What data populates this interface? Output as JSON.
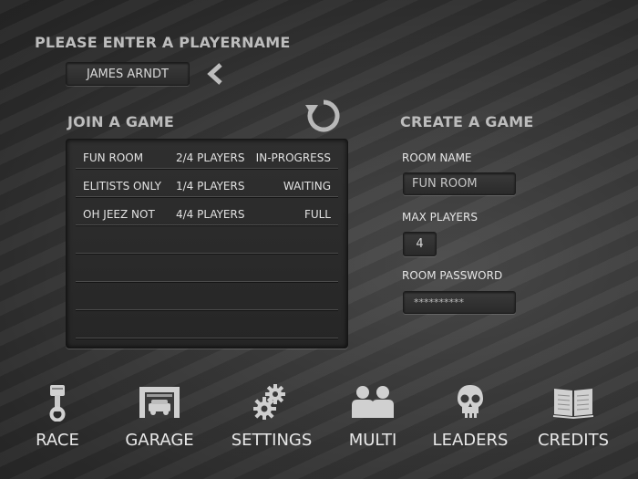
{
  "player": {
    "heading": "PLEASE ENTER A PLAYERNAME",
    "name_value": "JAMES ARNDT",
    "back_icon": "chevron-left-icon"
  },
  "join": {
    "heading": "JOIN A GAME",
    "refresh_icon": "refresh-icon",
    "rooms": [
      {
        "name": "FUN ROOM",
        "players": "2/4 PLAYERS",
        "status": "IN-PROGRESS"
      },
      {
        "name": "ELITISTS ONLY",
        "players": "1/4 PLAYERS",
        "status": "WAITING"
      },
      {
        "name": "OH JEEZ NOT",
        "players": "4/4 PLAYERS",
        "status": "FULL"
      }
    ]
  },
  "create": {
    "heading": "CREATE A GAME",
    "room_name_label": "ROOM NAME",
    "room_name_value": "FUN ROOM",
    "max_players_label": "MAX PLAYERS",
    "max_players_value": "4",
    "password_label": "ROOM PASSWORD",
    "password_value": "**********"
  },
  "nav": [
    {
      "label": "RACE",
      "icon": "piston-icon"
    },
    {
      "label": "GARAGE",
      "icon": "garage-icon"
    },
    {
      "label": "SETTINGS",
      "icon": "gears-icon"
    },
    {
      "label": "MULTI",
      "icon": "players-icon"
    },
    {
      "label": "LEADERS",
      "icon": "skull-icon"
    },
    {
      "label": "CREDITS",
      "icon": "book-icon"
    }
  ],
  "colors": {
    "background": "#3a3a3a",
    "text": "#d9d9d9",
    "heading": "#bdbdbd"
  }
}
